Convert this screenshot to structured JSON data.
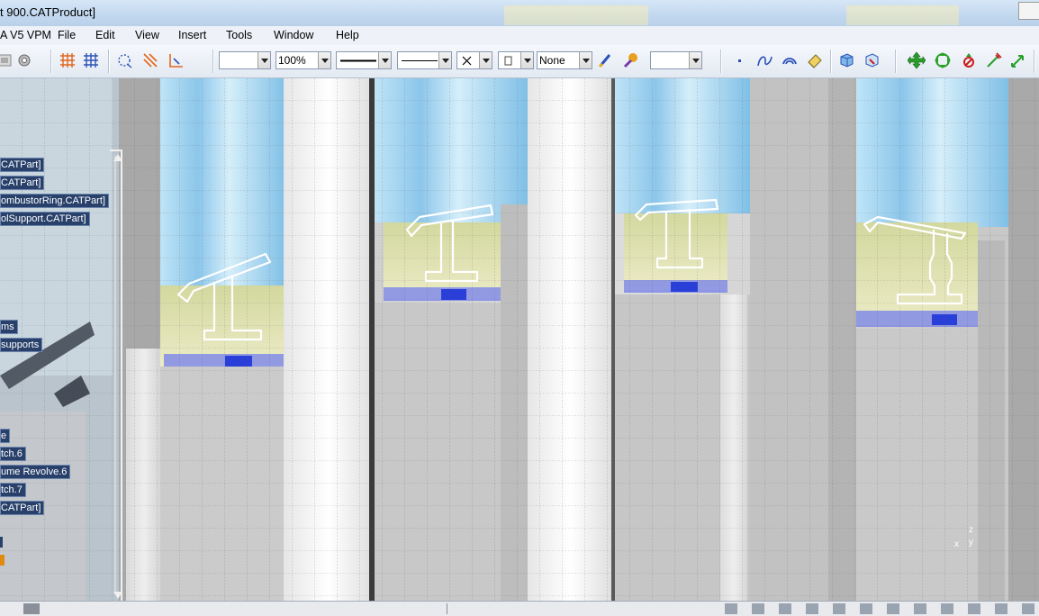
{
  "window": {
    "title": "t 900.CATProduct]"
  },
  "menubar": {
    "app_label": "A V5 VPM",
    "items": [
      "File",
      "Edit",
      "View",
      "Insert",
      "Tools",
      "Window",
      "Help"
    ]
  },
  "toolbar": {
    "zoom_value": "100%",
    "layer_value": "None"
  },
  "tree": {
    "nodes": [
      "CATPart]",
      "CATPart]",
      "ombustorRing.CATPart]",
      "olSupport.CATPart]",
      "ms",
      "supports",
      "e",
      "tch.6",
      "ume Revolve.6",
      "tch.7",
      "CATPart]"
    ]
  },
  "compass": {
    "z_label": "z",
    "x_label": "x",
    "y_label": "y"
  },
  "colors": {
    "tree_node_bg": "#28406a",
    "selection_white": "#ffffff",
    "sky_blue": "#a9d8f0",
    "floor_yellow": "#e6e7b8",
    "accent_blue": "#2a3fd8"
  }
}
